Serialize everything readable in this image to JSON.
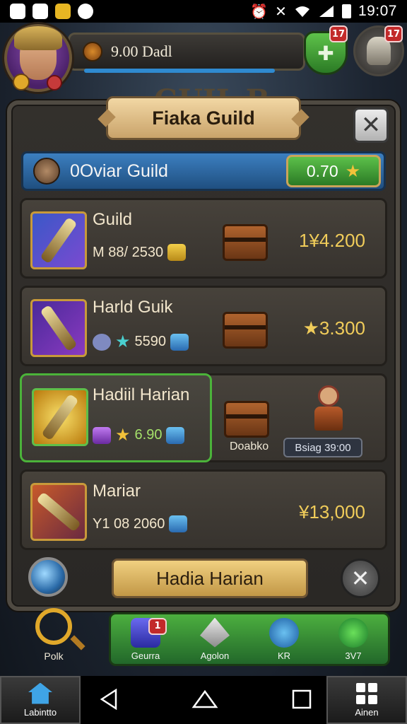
{
  "status_bar": {
    "time": "19:07"
  },
  "hud": {
    "gold_text": "9.00 Dadl",
    "notification_green": "17",
    "notification_helmet": "17",
    "background_banner": "GUIL B"
  },
  "dialog": {
    "title": "Fiaka Guild",
    "guild_row": {
      "name": "0Oviar Guild",
      "score": "0.70"
    },
    "items": [
      {
        "name": "Guild",
        "stats": "M 88/ 2530",
        "price": "1¥4.200"
      },
      {
        "name": "Harld Guik",
        "stats": "5590",
        "price": "★3.300"
      },
      {
        "name": "Hadiil Harian",
        "stats": "6.90",
        "price": "",
        "chest_label": "Doabko",
        "pill_label": "Bsiag 39:00"
      },
      {
        "name": "Mariar",
        "stats": "Y1 08 2060",
        "price": "¥13,000"
      }
    ],
    "bottom_button": "Hadia Harian"
  },
  "tray": {
    "search_label": "Polk",
    "buttons": [
      {
        "label": "Geurra",
        "badge": "1"
      },
      {
        "label": "Agolon"
      },
      {
        "label": "KR"
      },
      {
        "label": "3V7"
      }
    ]
  },
  "navbar": {
    "left_label": "Labintto",
    "right_label": "Ainen"
  },
  "colors": {
    "accent_blue": "#2f8ad0",
    "accent_green": "#4caf3f",
    "gold_text": "#f0cc5a",
    "panel_bg": "#33302c"
  }
}
